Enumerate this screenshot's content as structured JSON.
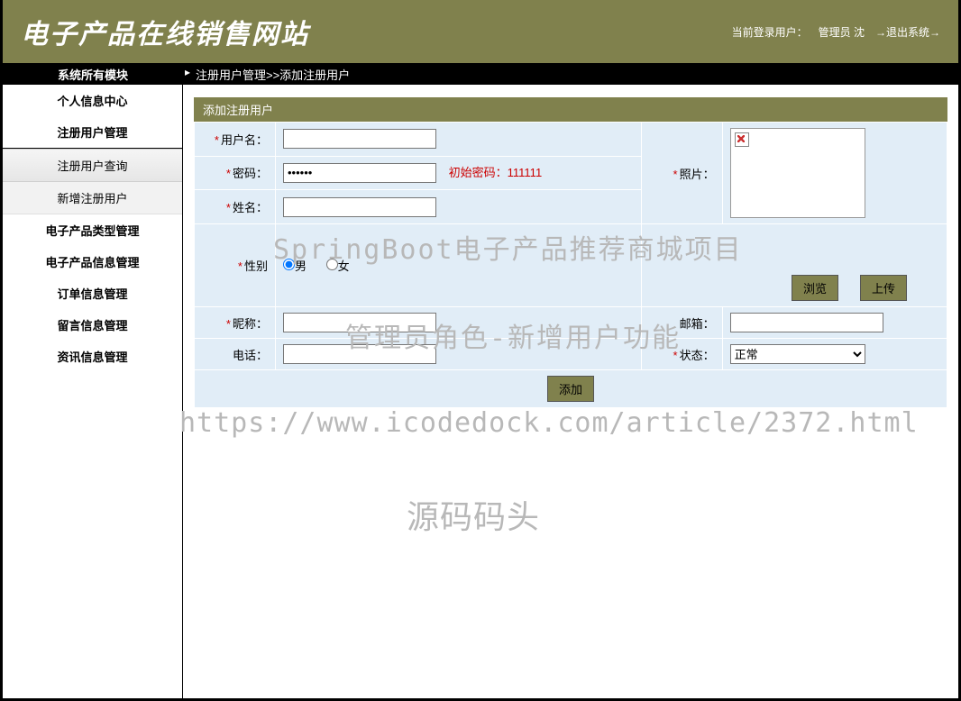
{
  "header": {
    "title": "电子产品在线销售网站",
    "current_user_label": "当前登录用户：",
    "current_user": "管理员 沈",
    "logout": "→退出系统→"
  },
  "topnav": {
    "left": "系统所有模块",
    "breadcrumb": "注册用户管理>>添加注册用户"
  },
  "sidebar": {
    "items": [
      "个人信息中心",
      "注册用户管理",
      "注册用户查询",
      "新增注册用户",
      "电子产品类型管理",
      "电子产品信息管理",
      "订单信息管理",
      "留言信息管理",
      "资讯信息管理"
    ]
  },
  "panel": {
    "title": "添加注册用户"
  },
  "form": {
    "username_label": "用户名：",
    "password_label": "密码：",
    "password_value": "••••••",
    "password_hint": "初始密码：111111",
    "name_label": "姓名：",
    "gender_label": "性别",
    "gender_male": "男",
    "gender_female": "女",
    "nickname_label": "昵称：",
    "phone_label": "电话：",
    "photo_label": "照片：",
    "browse": "浏览",
    "upload": "上传",
    "email_label": "邮箱：",
    "status_label": "状态：",
    "status_value": "正常",
    "submit": "添加"
  },
  "watermarks": {
    "w1": "SpringBoot电子产品推荐商城项目",
    "w2": "管理员角色-新增用户功能",
    "w3": "https://www.icodedock.com/article/2372.html",
    "w4": "源码码头"
  }
}
